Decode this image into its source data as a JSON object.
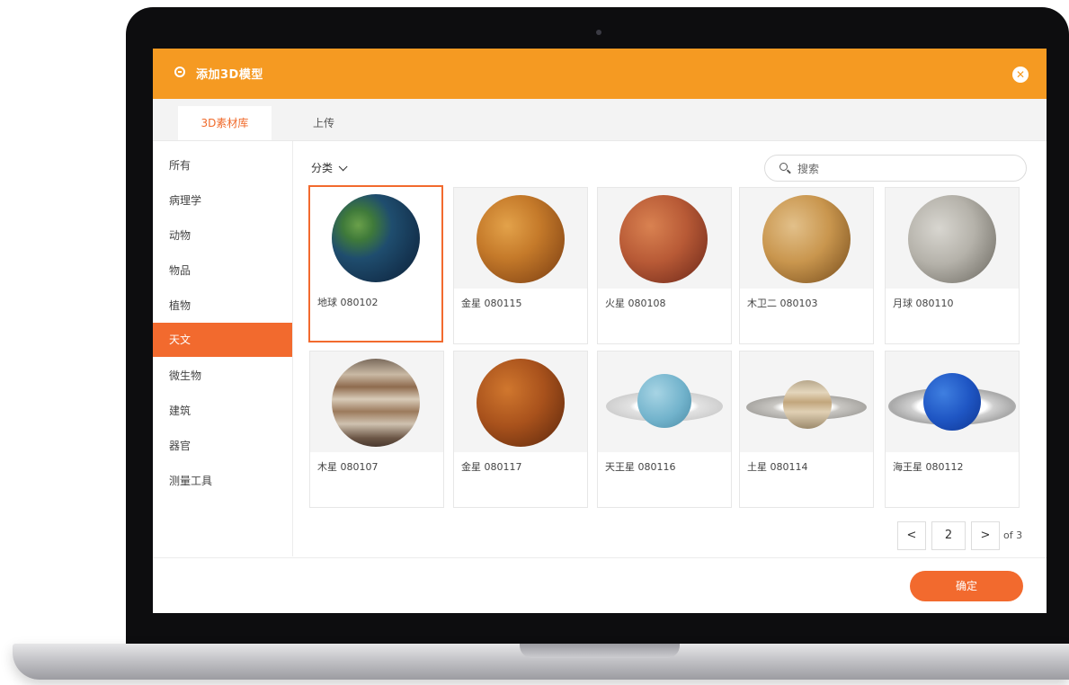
{
  "dialog": {
    "title": "添加3D模型",
    "close_label": "✕"
  },
  "tabs": [
    {
      "label": "3D素材库",
      "active": true
    },
    {
      "label": "上传",
      "active": false
    }
  ],
  "sidebar": {
    "items": [
      {
        "label": "所有"
      },
      {
        "label": "病理学"
      },
      {
        "label": "动物"
      },
      {
        "label": "物品"
      },
      {
        "label": "植物"
      },
      {
        "label": "天文",
        "active": true
      },
      {
        "label": "微生物"
      },
      {
        "label": "建筑"
      },
      {
        "label": "器官"
      },
      {
        "label": "测量工具"
      }
    ]
  },
  "filter": {
    "category_label": "分类"
  },
  "search": {
    "placeholder": "搜索",
    "value": ""
  },
  "models": [
    {
      "label": "地球 080102",
      "selected": true
    },
    {
      "label": "金星 080115",
      "selected": false
    },
    {
      "label": "火星 080108",
      "selected": false
    },
    {
      "label": "木卫二 080103",
      "selected": false
    },
    {
      "label": "月球 080110",
      "selected": false
    },
    {
      "label": "木星 080107",
      "selected": false
    },
    {
      "label": "金星 080117",
      "selected": false
    },
    {
      "label": "天王星 080116",
      "selected": false
    },
    {
      "label": "土星 080114",
      "selected": false
    },
    {
      "label": "海王星 080112",
      "selected": false
    }
  ],
  "pagination": {
    "prev_label": "<",
    "current_page": "2",
    "next_label": ">",
    "total_label": "of 3"
  },
  "footer": {
    "confirm_label": "确定"
  },
  "colors": {
    "accent": "#f26a2e",
    "header": "#f59a22"
  }
}
